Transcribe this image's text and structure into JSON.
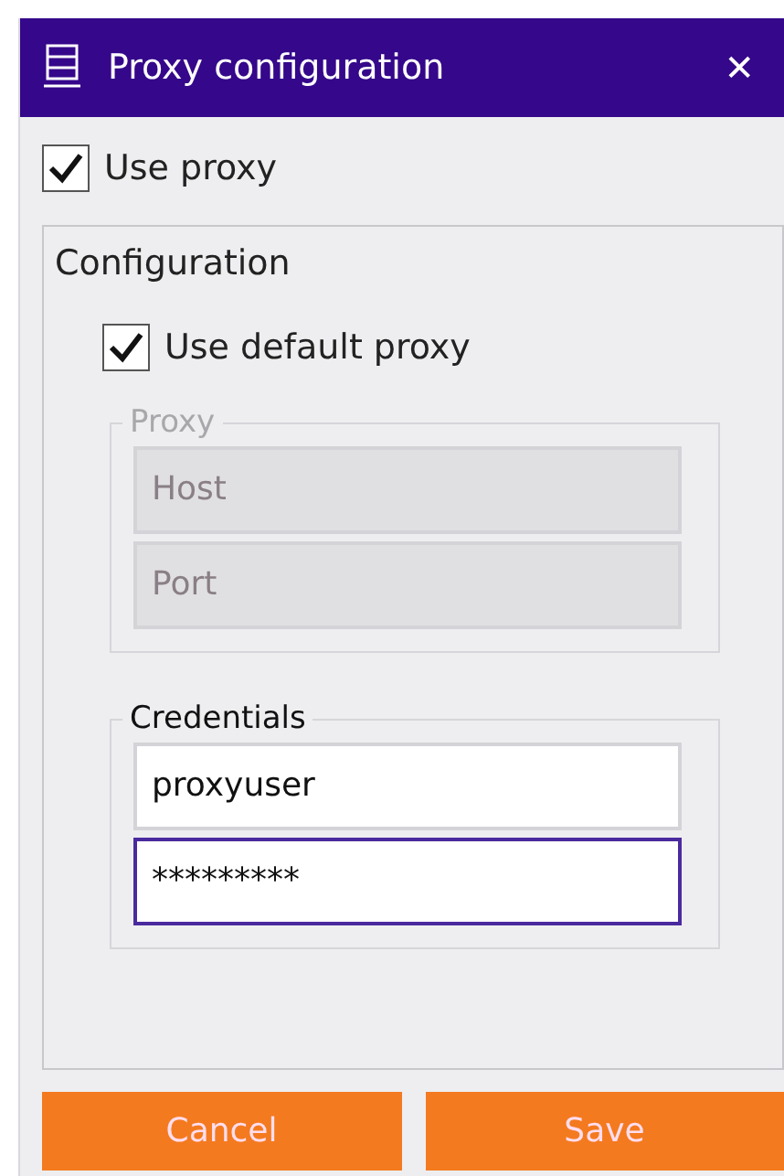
{
  "window": {
    "title": "Proxy configuration",
    "close": "✕"
  },
  "use_proxy": {
    "label": "Use proxy",
    "checked": true
  },
  "configuration": {
    "title": "Configuration",
    "use_default_proxy": {
      "label": "Use default proxy",
      "checked": true
    },
    "proxy": {
      "title": "Proxy",
      "disabled": true,
      "fields": [
        {
          "placeholder": "Host",
          "disabled": true,
          "focused": false
        },
        {
          "placeholder": "Port",
          "disabled": true,
          "focused": false
        }
      ]
    },
    "credentials": {
      "title": "Credentials",
      "disabled": false,
      "fields": [
        {
          "value": "proxyuser",
          "disabled": false,
          "focused": false
        },
        {
          "value": "*********",
          "disabled": false,
          "focused": true
        }
      ]
    }
  },
  "buttons": [
    "Cancel",
    "Save"
  ]
}
